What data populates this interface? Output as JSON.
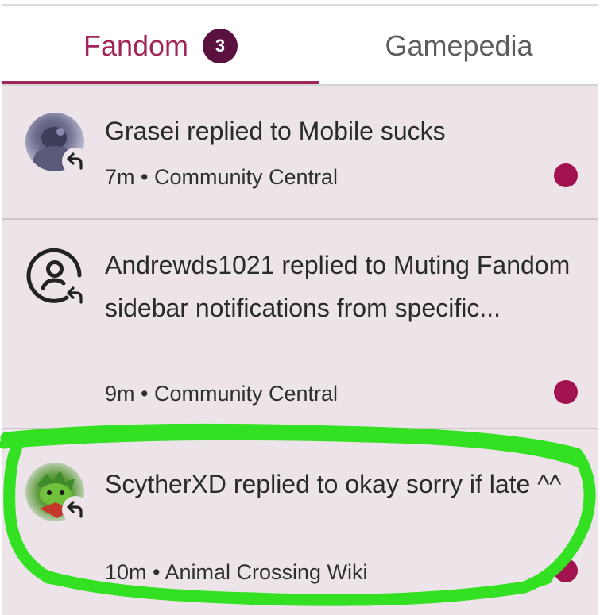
{
  "tabs": {
    "fandom": {
      "label": "Fandom",
      "badge_count": "3"
    },
    "gamepedia": {
      "label": "Gamepedia"
    }
  },
  "notifications": [
    {
      "title": "Grasei replied to Mobile sucks",
      "meta": "7m • Community Central",
      "avatar": "user-avatar-photo",
      "unread": true
    },
    {
      "title": "Andrewds1021 replied to Muting Fandom sidebar notifications from specific...",
      "meta": "9m • Community Central",
      "avatar": "default-user-icon",
      "unread": true
    },
    {
      "title": "ScytherXD replied to okay sorry if late ^^",
      "meta": "10m • Animal Crossing Wiki",
      "avatar": "user-avatar-photo",
      "unread": true
    }
  ],
  "colors": {
    "accent": "#a1265a",
    "badge": "#5a1140",
    "unread_dot": "#a1124f",
    "list_background": "#ede4ea",
    "highlight_annotation": "#33e022"
  }
}
